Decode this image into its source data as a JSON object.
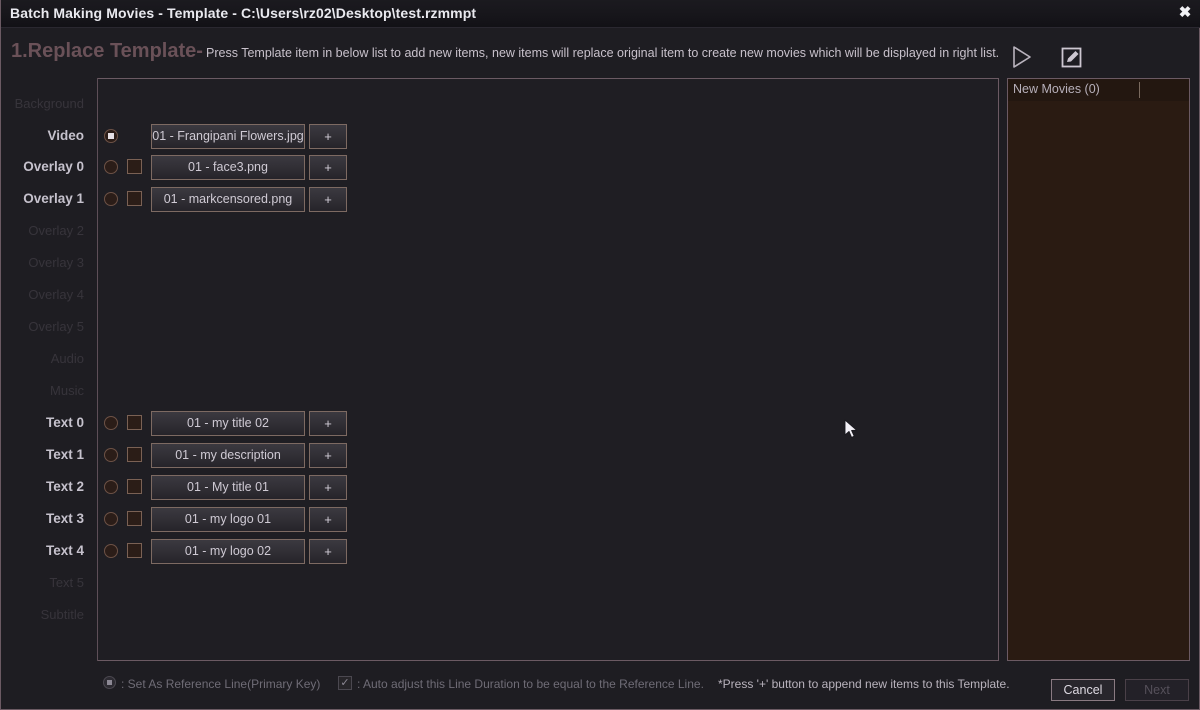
{
  "window": {
    "title": "Batch Making Movies - Template - C:\\Users\\rz02\\Desktop\\test.rzmmpt",
    "close_label": "✖"
  },
  "header": {
    "step_title": "1.Replace Template-",
    "step_desc": "Press Template item in below list to add new items, new items will replace original item to create new movies which will be displayed in right list.",
    "play_icon": "play-icon",
    "edit_icon": "edit-template-icon"
  },
  "rows": [
    {
      "label": "Background",
      "enabled": false,
      "radio": false,
      "checkbox": false,
      "item": null,
      "plus": null
    },
    {
      "label": "Video",
      "enabled": true,
      "radio": true,
      "radio_on": true,
      "checkbox": false,
      "item": "01 - Frangipani Flowers.jpg",
      "plus": "+"
    },
    {
      "label": "Overlay 0",
      "enabled": true,
      "radio": true,
      "radio_on": false,
      "checkbox": true,
      "item": "01 - face3.png",
      "plus": "+"
    },
    {
      "label": "Overlay 1",
      "enabled": true,
      "radio": true,
      "radio_on": false,
      "checkbox": true,
      "item": "01 - markcensored.png",
      "plus": "+"
    },
    {
      "label": "Overlay 2",
      "enabled": false,
      "radio": false,
      "checkbox": false,
      "item": null,
      "plus": null
    },
    {
      "label": "Overlay 3",
      "enabled": false,
      "radio": false,
      "checkbox": false,
      "item": null,
      "plus": null
    },
    {
      "label": "Overlay 4",
      "enabled": false,
      "radio": false,
      "checkbox": false,
      "item": null,
      "plus": null
    },
    {
      "label": "Overlay 5",
      "enabled": false,
      "radio": false,
      "checkbox": false,
      "item": null,
      "plus": null
    },
    {
      "label": "Audio",
      "enabled": false,
      "radio": false,
      "checkbox": false,
      "item": null,
      "plus": null
    },
    {
      "label": "Music",
      "enabled": false,
      "radio": false,
      "checkbox": false,
      "item": null,
      "plus": null
    },
    {
      "label": "Text 0",
      "enabled": true,
      "radio": true,
      "radio_on": false,
      "checkbox": true,
      "item": "01 - my title 02",
      "plus": "+"
    },
    {
      "label": "Text 1",
      "enabled": true,
      "radio": true,
      "radio_on": false,
      "checkbox": true,
      "item": "01 - my description",
      "plus": "+"
    },
    {
      "label": "Text 2",
      "enabled": true,
      "radio": true,
      "radio_on": false,
      "checkbox": true,
      "item": "01 - My title 01",
      "plus": "+"
    },
    {
      "label": "Text 3",
      "enabled": true,
      "radio": true,
      "radio_on": false,
      "checkbox": true,
      "item": "01 - my logo 01",
      "plus": "+"
    },
    {
      "label": "Text 4",
      "enabled": true,
      "radio": true,
      "radio_on": false,
      "checkbox": true,
      "item": "01 - my logo 02",
      "plus": "+"
    },
    {
      "label": "Text 5",
      "enabled": false,
      "radio": false,
      "checkbox": false,
      "item": null,
      "plus": null
    },
    {
      "label": "Subtitle",
      "enabled": false,
      "radio": false,
      "checkbox": false,
      "item": null,
      "plus": null
    }
  ],
  "right_panel": {
    "title": "New Movies (0)"
  },
  "footer": {
    "legend_reference": ": Set As Reference Line(Primary Key)",
    "legend_autoadjust": ": Auto adjust this Line Duration to be equal to the Reference Line.",
    "hint": "*Press '+' button to append new items to this Template.",
    "cancel_label": "Cancel",
    "next_label": "Next",
    "checkmark": "✓"
  },
  "colors": {
    "window_bg": "#1e1d22",
    "panel_border": "#6b5a63",
    "right_panel_bg": "#2a1b12",
    "accent_brown": "#7d6a62",
    "step_title": "#6a5158"
  }
}
